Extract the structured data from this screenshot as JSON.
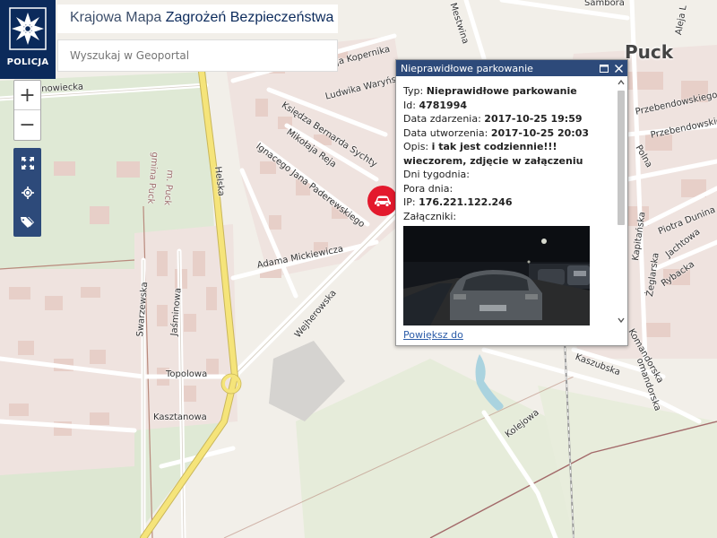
{
  "app": {
    "title_regular": "Krajowa Mapa ",
    "title_bold": "Zagrożeń Bezpieczeństwa",
    "logo_text": "POLICJA",
    "search_placeholder": "Wyszukaj w Geoportal",
    "zoom_in": "+",
    "zoom_out": "−"
  },
  "tools": [
    {
      "icon": "fullscreen-icon"
    },
    {
      "icon": "locate-icon"
    },
    {
      "icon": "tag-icon"
    }
  ],
  "map": {
    "town": "Puck",
    "streets": [
      "Sambora",
      "Aleja L",
      "Mestwina",
      "nowiecka",
      "aja Kopernika",
      "Ludwika Waryńsk",
      "Księdza Bernarda Sychty",
      "Mikołaja Reja",
      "Ignacego Jana Paderewskiego",
      "Adama Mickiewicza",
      "Helska",
      "Wejherowska",
      "gmina Puck",
      "m. Puck",
      "Swarzewska",
      "Jaśminowa",
      "Topolowa",
      "Kasztanowa",
      "Kolejowa",
      "Kaszubska",
      "Przebendowskiego",
      "Przebendowskiego",
      "Polna",
      "Piotra Dunina",
      "Jachtowa",
      "Rybacka",
      "Kapitańska",
      "Żeglarska",
      "Komandorska",
      "omandorska"
    ]
  },
  "marker": {
    "icon": "car-icon",
    "color": "#e3192d"
  },
  "popup": {
    "header": "Nieprawidłowe parkowanie",
    "rows": [
      {
        "label": "Typ: ",
        "value": "Nieprawidłowe parkowanie"
      },
      {
        "label": "Id: ",
        "value": "4781994"
      },
      {
        "label": "Data zdarzenia: ",
        "value": "2017-10-25 19:59"
      },
      {
        "label": "Data utworzenia: ",
        "value": "2017-10-25 20:03"
      },
      {
        "label": "Opis: ",
        "value": "i tak jest codziennie!!! wieczorem, zdjęcie w załączeniu"
      },
      {
        "label": "Dni tygodnia: ",
        "value": ""
      },
      {
        "label": "Pora dnia: ",
        "value": ""
      },
      {
        "label": "IP: ",
        "value": "176.221.122.246"
      },
      {
        "label": "Załączniki: ",
        "value": ""
      }
    ],
    "link": "Powiększ do"
  },
  "colors": {
    "brand_navy": "#0b2a5b",
    "toolbar_blue": "#2d4a7a",
    "marker_red": "#e3192d",
    "road_yellow": "#f5e47a",
    "building": "#e7cfc8"
  }
}
